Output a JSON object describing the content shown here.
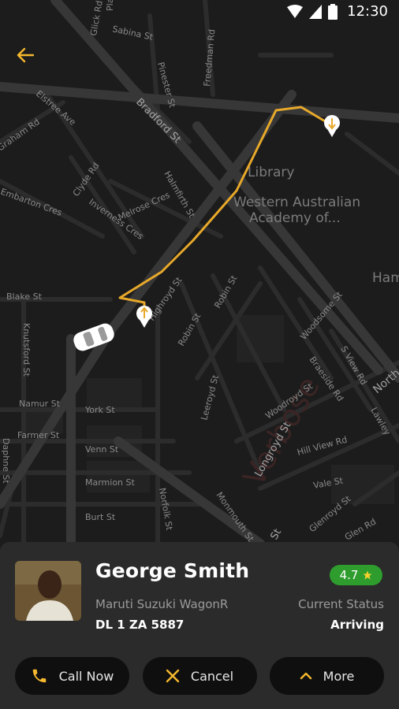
{
  "status_bar": {
    "time": "12:30"
  },
  "map": {
    "road_labels": [
      "Platina",
      "Glick Rd",
      "Sabina St",
      "Freedman Rd",
      "Pinester St",
      "Bradford St",
      "Elstree Ave",
      "Graham Rd",
      "Clyde Rd",
      "Halmfirth St",
      "Melrose Cres",
      "Embarton Cres",
      "Inverness Cres",
      "Blake St",
      "Knutsford St",
      "Highroyd St",
      "Robin St",
      "Robin St",
      "Woodsome St",
      "S View Rd",
      "Braeside Rd",
      "North",
      "Namur St",
      "York St",
      "Leeroyd St",
      "Woodroyd St",
      "Longroyd St",
      "Lawley",
      "Farmer St",
      "Hill View Rd",
      "Venn St",
      "Vale St",
      "Daphne St",
      "Marmion St",
      "Norfolk St",
      "Glenroyd St",
      "Burt St",
      "Monmouth St",
      "St",
      "Glen Rd"
    ],
    "poi_labels": [
      "Library",
      "Western Australian",
      "Academy of...",
      "Ham"
    ]
  },
  "driver": {
    "name": "George Smith",
    "car_model": "Maruti Suzuki WagonR",
    "plate": "DL 1  ZA 5887",
    "rating": "4.7",
    "status_label": "Current Status",
    "status_value": "Arriving"
  },
  "actions": [
    {
      "label": "Call Now",
      "icon": "phone-icon"
    },
    {
      "label": "Cancel",
      "icon": "close-icon"
    },
    {
      "label": "More",
      "icon": "chevron-up-icon"
    }
  ],
  "colors": {
    "accent": "#f5b82e",
    "route": "#e8a92a",
    "rating_bg": "#2e9d2e",
    "sheet_bg": "#2b2b2b",
    "map_bg": "#1b1b1b",
    "button_bg": "#0f0f0f"
  }
}
